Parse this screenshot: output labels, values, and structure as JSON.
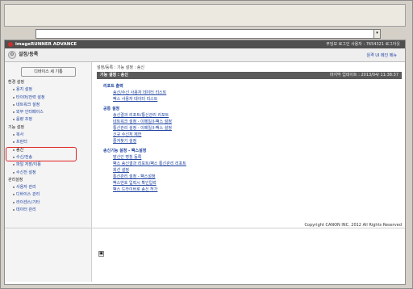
{
  "browser": {
    "dropdown_glyph": "▾"
  },
  "brand": {
    "name": "imageRUNNER ADVANCE",
    "status_right": "무딩모  로그인 사용자 : 7654321  로그아웃"
  },
  "titlebar": {
    "icon": "⚙",
    "title": "설정/등록",
    "portal_link": "원격 UI 메인 메뉴"
  },
  "sidebar": {
    "device_button": "디바이스 세 기통",
    "items": [
      {
        "type": "cat",
        "label": "환경 설정"
      },
      {
        "type": "item",
        "label": "용지 설정"
      },
      {
        "type": "item",
        "label": "타이머/전력 설정"
      },
      {
        "type": "item",
        "label": "네트워크 설정"
      },
      {
        "type": "item",
        "label": "외부 인터페이스"
      },
      {
        "type": "item",
        "label": "음량 조정"
      },
      {
        "type": "cat",
        "label": "기능 설정"
      },
      {
        "type": "item",
        "label": "복사"
      },
      {
        "type": "item",
        "label": "프린터"
      },
      {
        "type": "item",
        "label": "송신",
        "active": true
      },
      {
        "type": "item",
        "label": "수신/전송"
      },
      {
        "type": "item",
        "label": "파일 저장/이용"
      },
      {
        "type": "item",
        "label": "수신전 설정"
      },
      {
        "type": "cat",
        "label": "관리설정"
      },
      {
        "type": "item",
        "label": "사용자 관리"
      },
      {
        "type": "item",
        "label": "디바이스 관리"
      },
      {
        "type": "item",
        "label": "라이센스/기타"
      },
      {
        "type": "item",
        "label": "데이터 관리"
      }
    ]
  },
  "main": {
    "breadcrumb": "설정/등록 : 기능 설정 : 송신",
    "section_title": "기능 설정 : 송신",
    "last_updated": "마지막 업데이트 : 2013/04/ 11:38:37",
    "groups": [
      {
        "title": "리포트 출력",
        "items": [
          "송신/수신 사용자 데이터 리스트",
          "팩스 사용자 데이터 리스트"
        ]
      },
      {
        "title": "공통 설정",
        "items": [
          "송신결과 리포트/통신관리 리포트",
          "네트워크 설정 - 이메일/I-팩스 설정",
          "통신관리 설정 - 이메일/I-팩스 설정",
          "신규 수신처 제한",
          "즐겨찾기 설정"
        ]
      },
      {
        "title": "송신기능 설정 - 팩스설정",
        "items": [
          "발신인 명칭 등록",
          "팩스 송신결과 리포트/팩스 통신관리 리포트",
          "회선 설정",
          "통신관리 설정 - 팩스설정",
          "팩스번호 입력시 확인입력",
          "팩스 드라이버로 송신 허가"
        ]
      }
    ],
    "back_glyph": "▣"
  },
  "footer": {
    "copyright": "Copyright CANON INC. 2012 All Rights Reserved"
  },
  "colors": {
    "highlight": "#e02020",
    "link": "#1a3fa0"
  }
}
